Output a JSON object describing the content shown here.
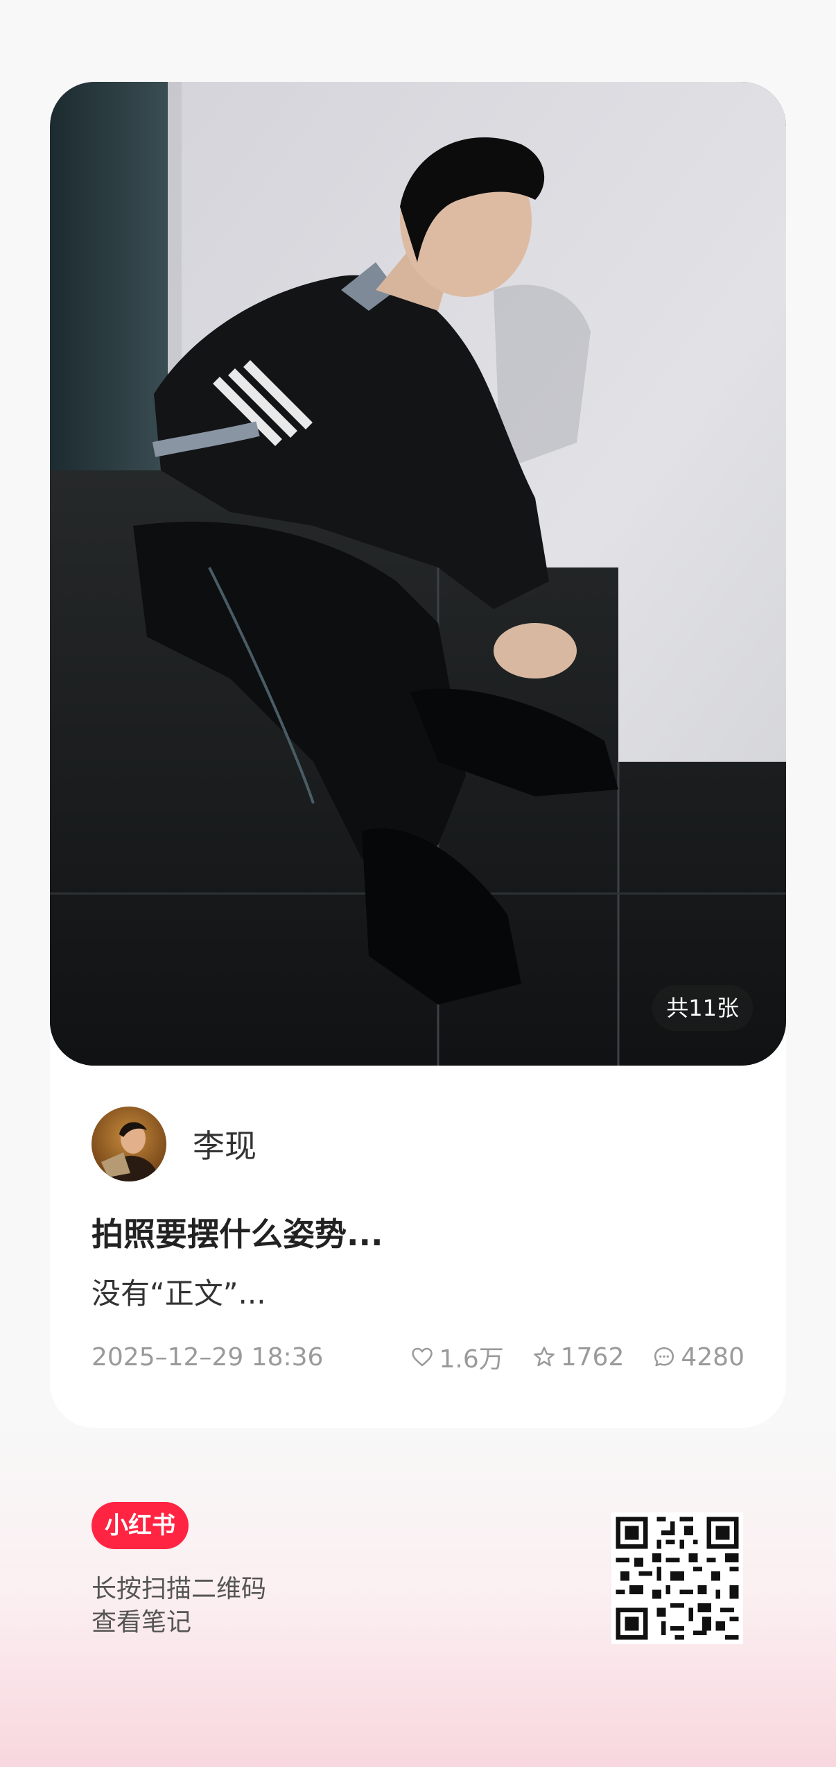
{
  "photo": {
    "count_label": "共11张"
  },
  "author": {
    "name": "李现",
    "avatar_icon": "user-avatar"
  },
  "post": {
    "title": "拍照要摆什么姿势...",
    "body": "没有“正文”..."
  },
  "meta": {
    "date": "2025–12–29 18:36",
    "likes": "1.6万",
    "stars": "1762",
    "comments": "4280",
    "icons": [
      "heart-icon",
      "star-icon",
      "comment-icon"
    ]
  },
  "footer": {
    "logo_text": "小红书",
    "line1": "长按扫描二维码",
    "line2": "查看笔记",
    "qr_icon": "qr-code"
  },
  "colors": {
    "brand": "#ff2442",
    "meta_gray": "#9a9a9a"
  }
}
